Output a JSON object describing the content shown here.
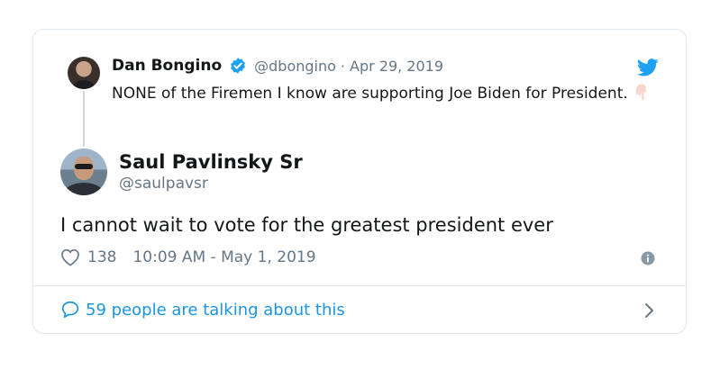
{
  "parent_tweet": {
    "author_name": "Dan Bongino",
    "handle": "@dbongino",
    "separator": "·",
    "date": "Apr 29, 2019",
    "text": "NONE of the Firemen I know are supporting Joe Biden for President.",
    "emoji": "pointing-down-emoji"
  },
  "main_tweet": {
    "author_name": "Saul Pavlinsky Sr",
    "handle": "@saulpavsr",
    "text": "I cannot wait to vote for the greatest president ever",
    "like_count": "138",
    "timestamp": "10:09 AM - May 1, 2019"
  },
  "footer": {
    "label": "59 people are talking about this"
  },
  "icons": {
    "verified": "verified-badge-icon",
    "brand": "twitter-bird-icon",
    "like": "heart-icon",
    "info": "info-icon",
    "reply": "speech-bubble-icon",
    "chevron": "chevron-right-icon"
  },
  "colors": {
    "brand_blue": "#1da1f2",
    "link_blue": "#1b95e0",
    "secondary_text": "#657786",
    "border": "#e1e8ed"
  }
}
